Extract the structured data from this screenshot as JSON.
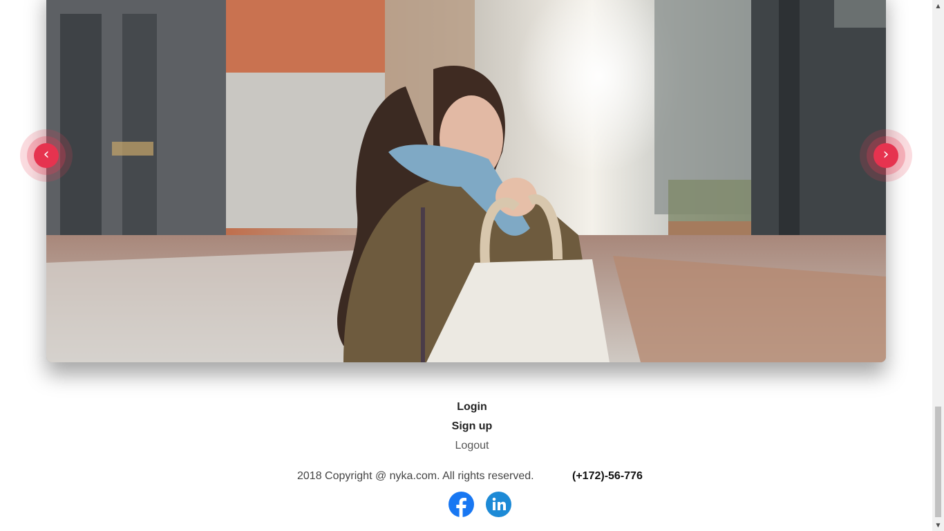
{
  "carousel": {
    "prev_label": "‹",
    "next_label": "›",
    "accent_color": "#e6334f"
  },
  "footer": {
    "links": {
      "login": "Login",
      "signup": "Sign up",
      "logout": "Logout"
    },
    "copyright": "2018 Copyright @ nyka.com. All rights reserved.",
    "phone": "(+172)-56-776",
    "social": {
      "facebook_icon": "facebook-icon",
      "linkedin_icon": "linkedin-icon"
    }
  },
  "scrollbar": {
    "up_arrow": "▲",
    "down_arrow": "▼"
  }
}
